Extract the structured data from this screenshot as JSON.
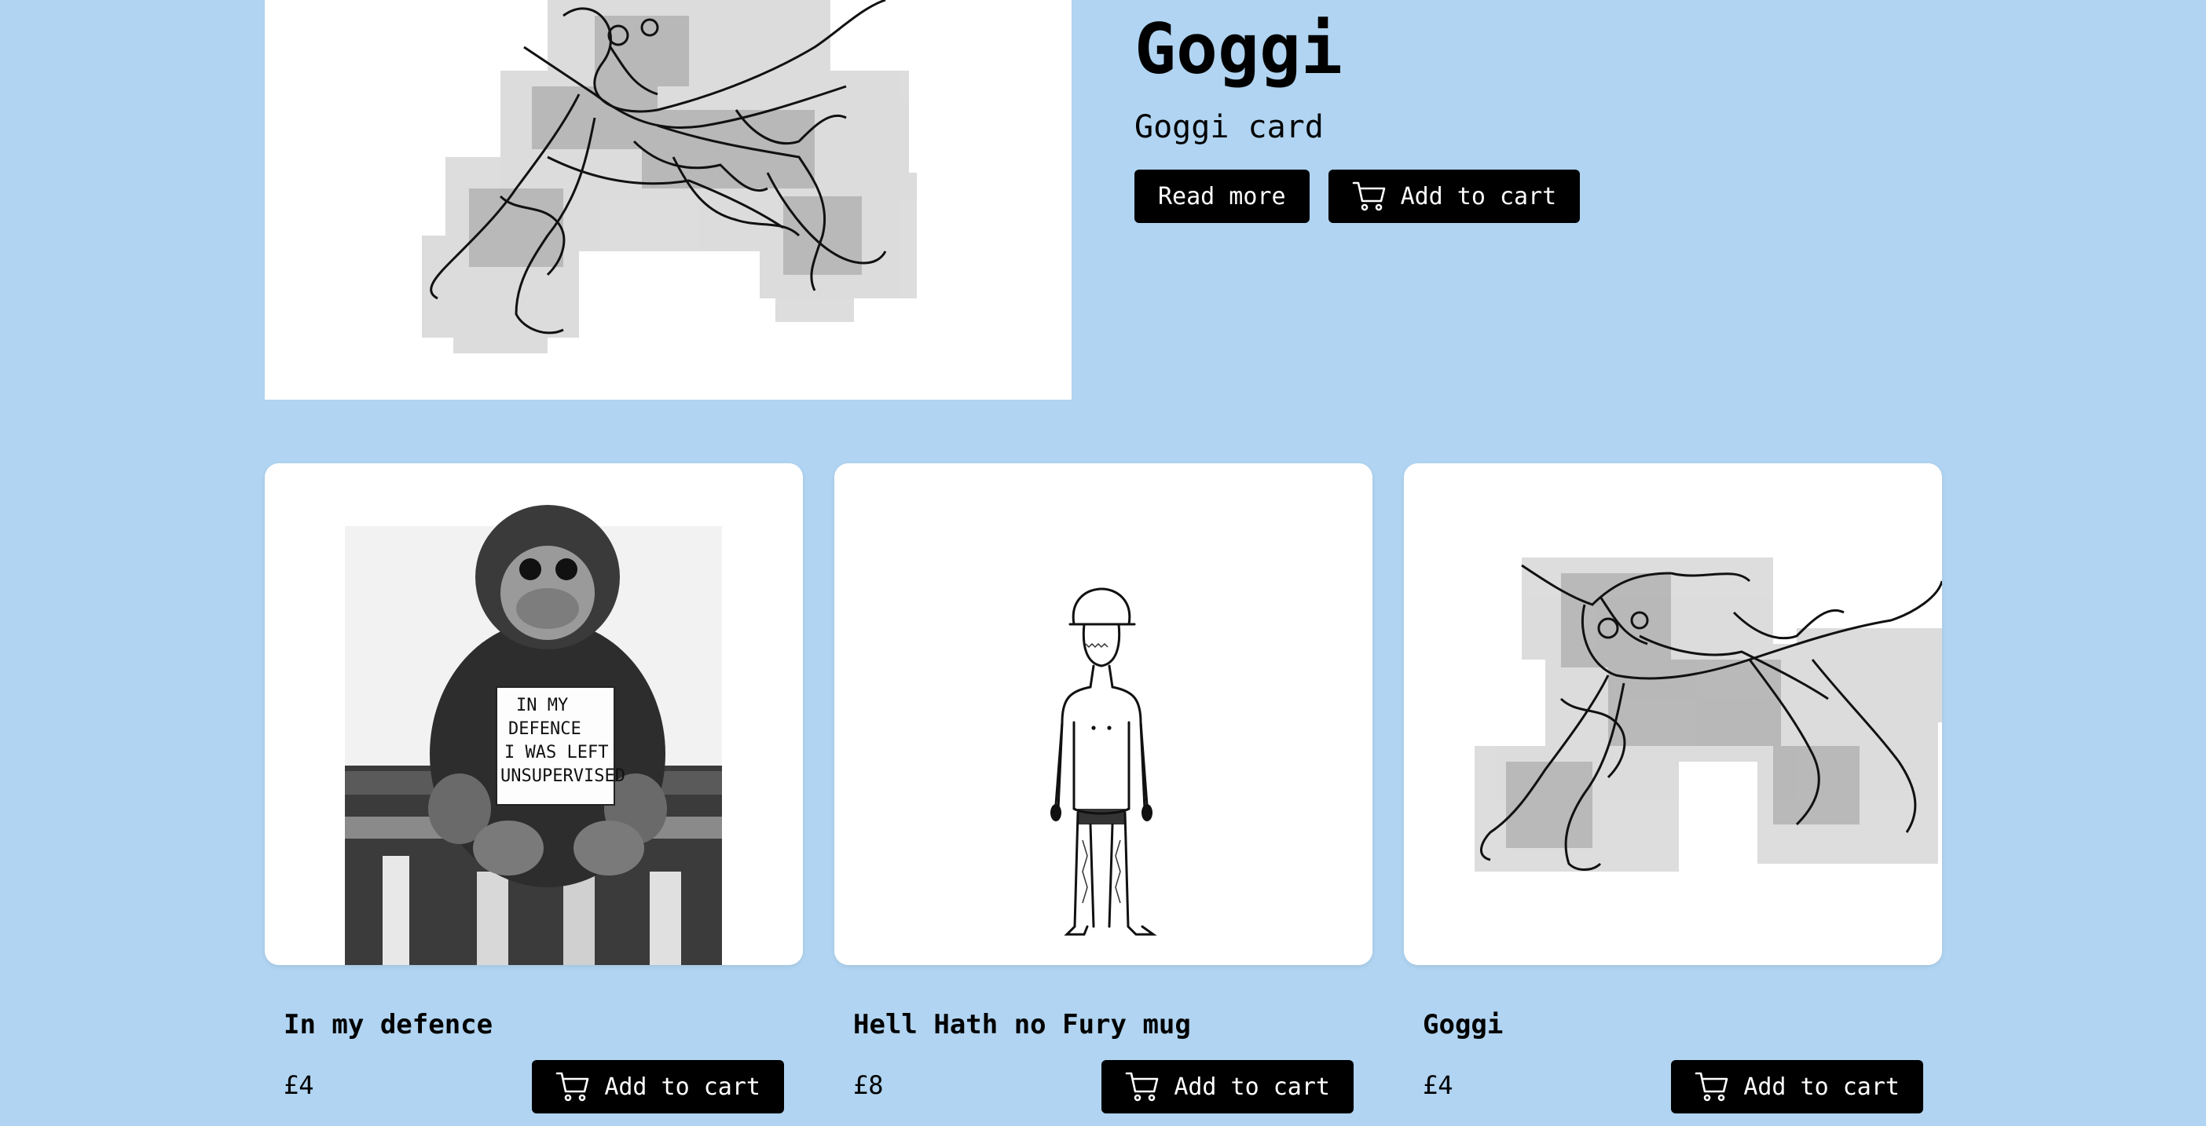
{
  "colors": {
    "background": "#b0d4f1",
    "button_bg": "#000000",
    "button_text": "#ffffff",
    "card_bg": "#ffffff"
  },
  "featured": {
    "title": "Goggi",
    "subtitle": "Goggi card",
    "read_more_label": "Read more",
    "add_to_cart_label": "Add to cart",
    "image_icon": "dog-scribble-illustration"
  },
  "products": [
    {
      "title": "In my defence",
      "price": "£4",
      "add_to_cart_label": "Add to cart",
      "image": "orangutan-plush-with-sign",
      "sign_lines": [
        "IN MY",
        "DEFENCE",
        "I WAS LEFT",
        "UNSUPERVISED"
      ]
    },
    {
      "title": "Hell Hath no Fury mug",
      "price": "£8",
      "add_to_cart_label": "Add to cart",
      "image": "standing-figure-line-drawing"
    },
    {
      "title": "Goggi",
      "price": "£4",
      "add_to_cart_label": "Add to cart",
      "image": "dog-scribble-illustration"
    }
  ],
  "icons": {
    "cart": "shopping-cart-icon"
  }
}
